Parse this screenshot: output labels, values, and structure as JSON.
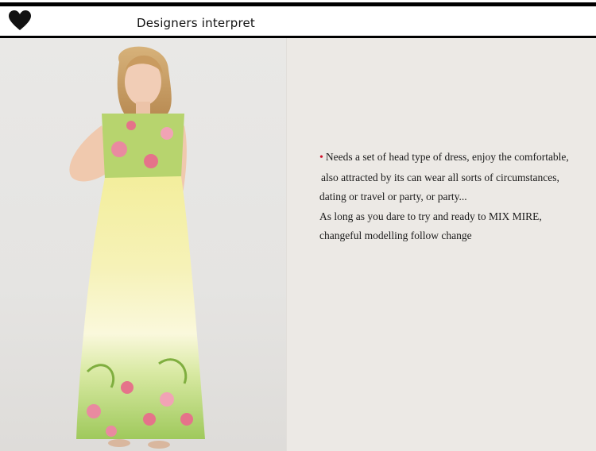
{
  "header": {
    "title": "Designers interpret",
    "icon": "heart-icon"
  },
  "description": {
    "bullet_color": "#d0102a",
    "lines": [
      "Needs a set of head type of dress, enjoy the comfortable,",
      " also attracted by its can wear all sorts of circumstances,",
      "dating or travel or party, or party...",
      "As long as you dare to try and ready to MIX MIRE,",
      "changeful modelling follow change"
    ]
  },
  "colors": {
    "rule": "#000000",
    "background": "#ece9e5",
    "dress_yellow": "#f2ec9e",
    "dress_green": "#a8cf62",
    "flower_pink": "#e5738a"
  }
}
